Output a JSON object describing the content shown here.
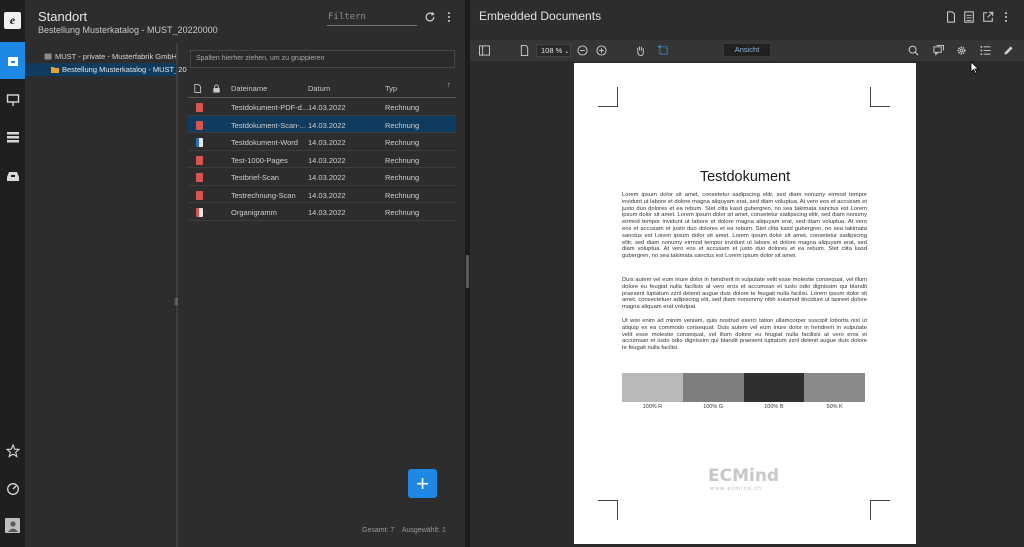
{
  "rail": {
    "logo_letter": "e",
    "items": [
      "home-icon",
      "presentation-icon",
      "stack-icon",
      "inbox-icon"
    ],
    "bottom": [
      "star-icon",
      "gauge-icon",
      "user-icon"
    ],
    "accent": "#1e88e5"
  },
  "left": {
    "title": "Standort",
    "subtitle": "Bestellung Musterkatalog - MUST_20220000",
    "filter_placeholder": "Filtern",
    "tree": [
      {
        "label": "MUST - private - Musterfabrik GmbH"
      },
      {
        "label": "Bestellung Musterkatalog - MUST_20"
      }
    ],
    "group_hint": "Spalten hierher ziehen, um zu gruppieren",
    "columns": [
      "Dateiname",
      "Datum",
      "Typ"
    ],
    "rows": [
      {
        "name": "Testdokument-PDF-d...",
        "date": "14.03.2022",
        "type": "Rechnung",
        "icon": "pdf"
      },
      {
        "name": "Testdokument-Scan-...",
        "date": "14.03.2022",
        "type": "Rechnung",
        "icon": "pdf"
      },
      {
        "name": "Testdokument-Word",
        "date": "14.03.2022",
        "type": "Rechnung",
        "icon": "word"
      },
      {
        "name": "Test-1000-Pages",
        "date": "14.03.2022",
        "type": "Rechnung",
        "icon": "pdf"
      },
      {
        "name": "Testbrief-Scan",
        "date": "14.03.2022",
        "type": "Rechnung",
        "icon": "pdf"
      },
      {
        "name": "Testrechnung-Scan",
        "date": "14.03.2022",
        "type": "Rechnung",
        "icon": "pdf"
      },
      {
        "name": "Organigramm",
        "date": "14.03.2022",
        "type": "Rechnung",
        "icon": "ppt"
      }
    ],
    "selected_row": 1,
    "add_label": "+",
    "footer": {
      "total": "Gesamt: 7",
      "selected": "Ausgewählt: 1"
    }
  },
  "right": {
    "title": "Embedded Documents",
    "zoom": "108 %",
    "ansicht": "Ansicht",
    "document": {
      "title": "Testdokument",
      "para1": "Lorem ipsum dolor sit amet, consetetur sadipscing elitr, sed diam nonumy eirmod tempor invidunt ut labore et dolore magna aliquyam erat, sed diam voluptua. At vero eos et accusam et justo duo dolores et ea rebum. Stet clita kasd gubergren, no sea takimata sanctus est Lorem ipsum dolor sit amet. Lorem ipsum dolor sit amet, consetetur sadipscing elitr, sed diam nonumy eirmod tempor invidunt ut labore et dolore magna aliquyam erat, sed diam voluptua. At vero eos et accusam et justo duo dolores et ea rebum. Stet clita kasd gubergren, no sea takimata sanctus est Lorem ipsum dolor sit amet. Lorem ipsum dolor sit amet, consetetur sadipscing elitr, sed diam nonumy eirmod tempor invidunt ut labore et dolore magna aliquyam erat, sed diam voluptua. At vero eos et accusam et justo duo dolores et ea rebum. Stet clita kasd gubergren, no sea takimata sanctus est Lorem ipsum dolor sit amet.",
      "para2": "Duis autem vel eum iriure dolor in hendrerit in vulputate velit esse molestie consequat, vel illum dolore eu feugiat nulla facilisis at vero eros et accumsan et iusto odio dignissim qui blandit praesent luptatum zzril delenit augue duis dolore te feugait nulla facilisi. Lorem ipsum dolor sit amet, consectetuer adipiscing elit, sed diam nonummy nibh euismod tincidunt ut laoreet dolore magna aliquam erat volutpat.",
      "para3": "Ut wisi enim ad minim veniam, quis nostrud exerci tation ullamcorper suscipit lobortis nisl ut aliquip ex ea commodo consequat. Duis autem vel eum iriure dolor in hendrerit in vulputate velit esse molestie consequat, vel illum dolore eu feugiat nulla facilisis at vero eros et accumsan et iusto odio dignissim qui blandit praesent luptatum zzril delenit augue duis dolore te feugait nulla facilisi.",
      "bars": [
        "100% R",
        "100% G",
        "100% B",
        "50% K"
      ],
      "logo": "ECMind",
      "logo_sub": "www.ecmind.ch"
    }
  }
}
